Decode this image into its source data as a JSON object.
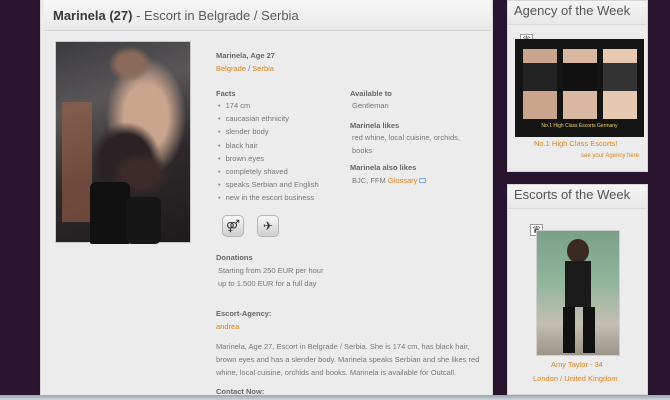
{
  "header": {
    "name_age": "Marinela (27)",
    "title_rest": " - Escort in Belgrade / Serbia"
  },
  "profile": {
    "name_line": "Marinela, Age 27",
    "city": "Belgrade",
    "sep": " / ",
    "country": "Serbia",
    "facts_label": "Facts",
    "facts": [
      "174 cm",
      "caucasian ethnicity",
      "slender body",
      "black hair",
      "brown eyes",
      "completely shaved",
      "speaks Serbian and English",
      "new in the escort business"
    ],
    "available_label": "Available to",
    "available_value": "Gentleman",
    "likes_label": "Marinela likes",
    "likes_line1": "red whine, local cuisine, orchids,",
    "likes_line2": "books",
    "also_likes_label": "Marinela also likes",
    "also_likes_value": "BJC, FFM",
    "glossary_link": "Glossary",
    "donations_label": "Donations",
    "donations_line1": "Starting from 250 EUR per hour",
    "donations_line2": "up to 1.500 EUR for a full day",
    "agency_label": "Escort-Agency:",
    "agency_value": "andrea",
    "description": "Marinela, Age 27, Escort in Belgrade / Serbia. She is 174 cm, has black hair, brown eyes and has a slender body. Marinela speaks Serbian and she likes red whine, local cuisine, orchids and books. Marinela is available for Outcall.",
    "contact_label": "Contact Now:"
  },
  "agency_week": {
    "title": "Agency of the Week",
    "image_caption": "No.1 High Class Escorts Germany",
    "link": "No.1 High Class Escorts!",
    "small_link": "see your Agency here"
  },
  "escorts_week": {
    "title": "Escorts of the Week",
    "name_age": "Amy Taylor - 34",
    "location": "London / United Kingdom"
  },
  "icons": {
    "crown": "♛",
    "gay_friendly": "⚤",
    "travel": "✈"
  }
}
